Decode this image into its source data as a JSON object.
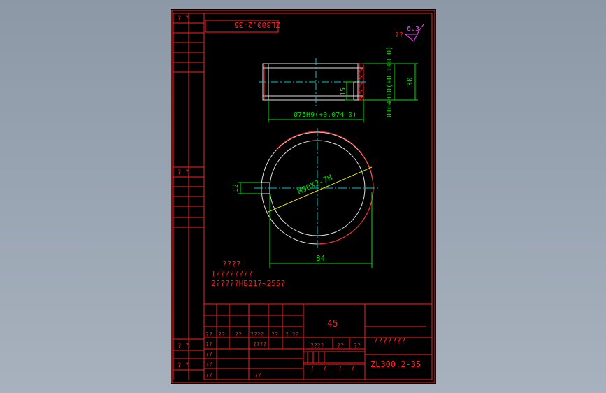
{
  "drawing": {
    "part_code_mirrored": "ZL300.2-35",
    "roughness_prefix": "??",
    "roughness_value": "6.3",
    "left_strip": {
      "label_top": "?   ?",
      "label_mid": "?   ?",
      "label_bot1": "?   ?",
      "label_bot2": "?   ?"
    },
    "section_view": {
      "dim_bore": "Ø75H9(+0.074 0)",
      "dim_outer": "Ø104H10(+0.140 0)",
      "dim_height": "30",
      "dim_depth": "15"
    },
    "top_view": {
      "dim_thread": "M90X2-7H",
      "dim_slot": "12",
      "dim_width": "84"
    },
    "notes": {
      "title": "????",
      "line1": "1????????",
      "line2": "2?????HB217~255?"
    },
    "title_block": {
      "material": "45",
      "name": "???????",
      "drawing_no": "ZL300.2-35",
      "row_labels": [
        "??",
        "??",
        "??",
        "????",
        "??",
        "?.??"
      ],
      "mid_labels": [
        "????",
        "??",
        "??"
      ],
      "bottom_labels": [
        "?",
        "?",
        "?",
        "?"
      ],
      "left_labels": [
        "??",
        "??",
        "??",
        "??"
      ],
      "aux_label": "????",
      "sheet_label": "??"
    }
  }
}
